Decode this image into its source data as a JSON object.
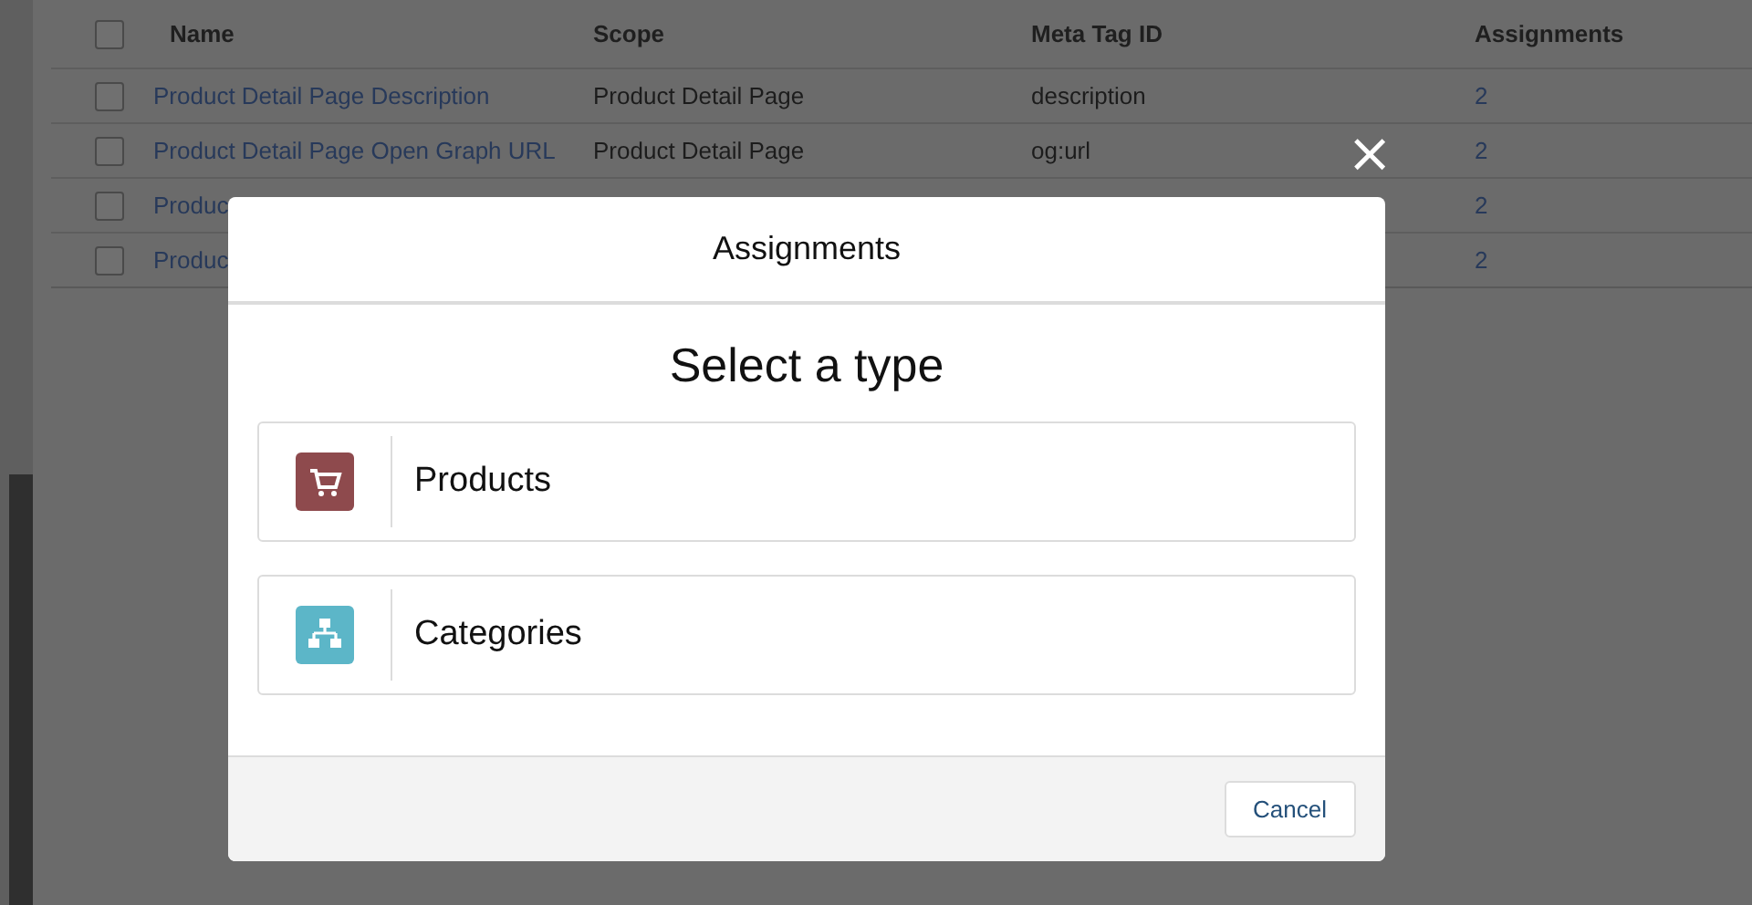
{
  "table": {
    "all_checked": false,
    "columns": [
      "Name",
      "Scope",
      "Meta Tag ID",
      "Assignments"
    ],
    "rows": [
      {
        "name": "Product Detail Page Description",
        "scope": "Product Detail Page",
        "meta_tag_id": "description",
        "assignments": "2",
        "checked": false
      },
      {
        "name": "Product Detail Page Open Graph URL",
        "scope": "Product Detail Page",
        "meta_tag_id": "og:url",
        "assignments": "2",
        "checked": false
      },
      {
        "name": "Produc",
        "assignments": "2",
        "checked": false
      },
      {
        "name": "Produc",
        "assignments": "2",
        "checked": false
      }
    ]
  },
  "modal": {
    "close": "×",
    "title": "Assignments",
    "heading": "Select a type",
    "options": [
      {
        "kind": "products",
        "label": "Products",
        "color": "#8e4a4d"
      },
      {
        "kind": "categories",
        "label": "Categories",
        "color": "#5cb6c8"
      }
    ],
    "buttons": [
      "Cancel"
    ]
  }
}
